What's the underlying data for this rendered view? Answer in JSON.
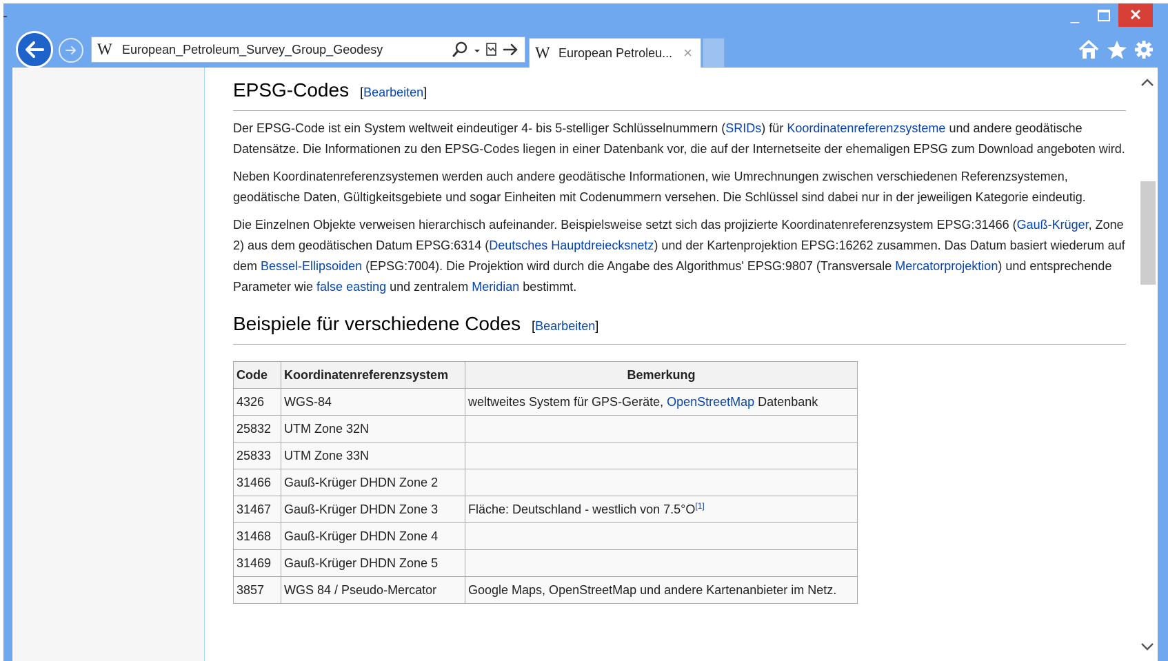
{
  "browser": {
    "address": "European_Petroleum_Survey_Group_Geodesy",
    "tab_title": "European Petroleu...",
    "tab_close": "×",
    "wiki_glyph": "W",
    "controls": {
      "minimize": "_",
      "close": "✕"
    }
  },
  "article": {
    "heading1": "EPSG-Codes",
    "edit_label": "Bearbeiten",
    "bracket_open": "[",
    "bracket_close": "]",
    "p1": {
      "a": "Der EPSG-Code ist ein System weltweit eindeutiger 4- bis 5-stelliger Schlüsselnummern (",
      "link1": "SRIDs",
      "b": ") für ",
      "link2": "Koordinatenreferenzsysteme",
      "c": " und andere geodätische Datensätze. Die Informationen zu den EPSG-Codes liegen in einer Datenbank vor, die auf der Internetseite der ehemaligen EPSG zum Download angeboten wird."
    },
    "p2": "Neben Koordinatenreferenzsystemen werden auch andere geodätische Informationen, wie Umrechnungen zwischen verschiedenen Referenzsystemen, geodätische Daten, Gültigkeitsgebiete und sogar Einheiten mit Codenummern versehen. Die Schlüssel sind dabei nur in der jeweiligen Kategorie eindeutig.",
    "p3": {
      "a": "Die Einzelnen Objekte verweisen hierarchisch aufeinander. Beispielsweise setzt sich das projizierte Koordinatenreferenzsystem EPSG:31466 (",
      "link1": "Gauß-Krüger",
      "b": ", Zone 2) aus dem geodätischen Datum EPSG:6314 (",
      "link2": "Deutsches Hauptdreiecksnetz",
      "c": ") und der Kartenprojektion EPSG:16262 zusammen. Das Datum basiert wiederum auf dem ",
      "link3": "Bessel-Ellipsoiden",
      "d": " (EPSG:7004). Die Projektion wird durch die Angabe des Algorithmus' EPSG:9807 (Transversale ",
      "link4": "Mercatorprojektion",
      "e": ") und entsprechende Parameter wie ",
      "link5": "false easting",
      "f": " und zentralem ",
      "link6": "Meridian",
      "g": " bestimmt."
    },
    "heading2": "Beispiele für verschiedene Codes",
    "table": {
      "headers": [
        "Code",
        "Koordinatenreferenzsystem",
        "Bemerkung"
      ],
      "rows": [
        {
          "code": "4326",
          "system": "WGS-84",
          "remark_a": "weltweites System für GPS-Geräte, ",
          "remark_link": "OpenStreetMap",
          "remark_b": " Datenbank"
        },
        {
          "code": "25832",
          "system": "UTM Zone 32N",
          "remark": ""
        },
        {
          "code": "25833",
          "system": "UTM Zone 33N",
          "remark": ""
        },
        {
          "code": "31466",
          "system": "Gauß-Krüger DHDN Zone 2",
          "remark": ""
        },
        {
          "code": "31467",
          "system": "Gauß-Krüger DHDN Zone 3",
          "remark": "Fläche: Deutschland - westlich von 7.5°O",
          "ref": "[1]"
        },
        {
          "code": "31468",
          "system": "Gauß-Krüger DHDN Zone 4",
          "remark": ""
        },
        {
          "code": "31469",
          "system": "Gauß-Krüger DHDN Zone 5",
          "remark": ""
        },
        {
          "code": "3857",
          "system": "WGS 84 / Pseudo-Mercator",
          "remark": "Google Maps, OpenStreetMap und andere Kartenanbieter im Netz."
        }
      ]
    }
  },
  "colors": {
    "frame": "#6fa8ee",
    "link": "#0645ad",
    "back_button": "#1e63c9",
    "close_button": "#d74036"
  },
  "icons": [
    "back-arrow-icon",
    "forward-arrow-icon",
    "search-icon",
    "compat-view-icon",
    "go-arrow-icon",
    "home-icon",
    "star-icon",
    "gear-icon"
  ]
}
